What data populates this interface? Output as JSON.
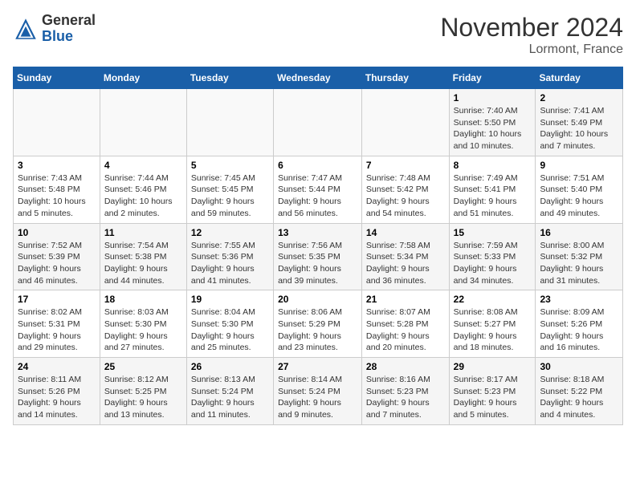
{
  "header": {
    "logo_general": "General",
    "logo_blue": "Blue",
    "month_year": "November 2024",
    "location": "Lormont, France"
  },
  "weekdays": [
    "Sunday",
    "Monday",
    "Tuesday",
    "Wednesday",
    "Thursday",
    "Friday",
    "Saturday"
  ],
  "weeks": [
    [
      {
        "day": "",
        "info": ""
      },
      {
        "day": "",
        "info": ""
      },
      {
        "day": "",
        "info": ""
      },
      {
        "day": "",
        "info": ""
      },
      {
        "day": "",
        "info": ""
      },
      {
        "day": "1",
        "info": "Sunrise: 7:40 AM\nSunset: 5:50 PM\nDaylight: 10 hours and 10 minutes."
      },
      {
        "day": "2",
        "info": "Sunrise: 7:41 AM\nSunset: 5:49 PM\nDaylight: 10 hours and 7 minutes."
      }
    ],
    [
      {
        "day": "3",
        "info": "Sunrise: 7:43 AM\nSunset: 5:48 PM\nDaylight: 10 hours and 5 minutes."
      },
      {
        "day": "4",
        "info": "Sunrise: 7:44 AM\nSunset: 5:46 PM\nDaylight: 10 hours and 2 minutes."
      },
      {
        "day": "5",
        "info": "Sunrise: 7:45 AM\nSunset: 5:45 PM\nDaylight: 9 hours and 59 minutes."
      },
      {
        "day": "6",
        "info": "Sunrise: 7:47 AM\nSunset: 5:44 PM\nDaylight: 9 hours and 56 minutes."
      },
      {
        "day": "7",
        "info": "Sunrise: 7:48 AM\nSunset: 5:42 PM\nDaylight: 9 hours and 54 minutes."
      },
      {
        "day": "8",
        "info": "Sunrise: 7:49 AM\nSunset: 5:41 PM\nDaylight: 9 hours and 51 minutes."
      },
      {
        "day": "9",
        "info": "Sunrise: 7:51 AM\nSunset: 5:40 PM\nDaylight: 9 hours and 49 minutes."
      }
    ],
    [
      {
        "day": "10",
        "info": "Sunrise: 7:52 AM\nSunset: 5:39 PM\nDaylight: 9 hours and 46 minutes."
      },
      {
        "day": "11",
        "info": "Sunrise: 7:54 AM\nSunset: 5:38 PM\nDaylight: 9 hours and 44 minutes."
      },
      {
        "day": "12",
        "info": "Sunrise: 7:55 AM\nSunset: 5:36 PM\nDaylight: 9 hours and 41 minutes."
      },
      {
        "day": "13",
        "info": "Sunrise: 7:56 AM\nSunset: 5:35 PM\nDaylight: 9 hours and 39 minutes."
      },
      {
        "day": "14",
        "info": "Sunrise: 7:58 AM\nSunset: 5:34 PM\nDaylight: 9 hours and 36 minutes."
      },
      {
        "day": "15",
        "info": "Sunrise: 7:59 AM\nSunset: 5:33 PM\nDaylight: 9 hours and 34 minutes."
      },
      {
        "day": "16",
        "info": "Sunrise: 8:00 AM\nSunset: 5:32 PM\nDaylight: 9 hours and 31 minutes."
      }
    ],
    [
      {
        "day": "17",
        "info": "Sunrise: 8:02 AM\nSunset: 5:31 PM\nDaylight: 9 hours and 29 minutes."
      },
      {
        "day": "18",
        "info": "Sunrise: 8:03 AM\nSunset: 5:30 PM\nDaylight: 9 hours and 27 minutes."
      },
      {
        "day": "19",
        "info": "Sunrise: 8:04 AM\nSunset: 5:30 PM\nDaylight: 9 hours and 25 minutes."
      },
      {
        "day": "20",
        "info": "Sunrise: 8:06 AM\nSunset: 5:29 PM\nDaylight: 9 hours and 23 minutes."
      },
      {
        "day": "21",
        "info": "Sunrise: 8:07 AM\nSunset: 5:28 PM\nDaylight: 9 hours and 20 minutes."
      },
      {
        "day": "22",
        "info": "Sunrise: 8:08 AM\nSunset: 5:27 PM\nDaylight: 9 hours and 18 minutes."
      },
      {
        "day": "23",
        "info": "Sunrise: 8:09 AM\nSunset: 5:26 PM\nDaylight: 9 hours and 16 minutes."
      }
    ],
    [
      {
        "day": "24",
        "info": "Sunrise: 8:11 AM\nSunset: 5:26 PM\nDaylight: 9 hours and 14 minutes."
      },
      {
        "day": "25",
        "info": "Sunrise: 8:12 AM\nSunset: 5:25 PM\nDaylight: 9 hours and 13 minutes."
      },
      {
        "day": "26",
        "info": "Sunrise: 8:13 AM\nSunset: 5:24 PM\nDaylight: 9 hours and 11 minutes."
      },
      {
        "day": "27",
        "info": "Sunrise: 8:14 AM\nSunset: 5:24 PM\nDaylight: 9 hours and 9 minutes."
      },
      {
        "day": "28",
        "info": "Sunrise: 8:16 AM\nSunset: 5:23 PM\nDaylight: 9 hours and 7 minutes."
      },
      {
        "day": "29",
        "info": "Sunrise: 8:17 AM\nSunset: 5:23 PM\nDaylight: 9 hours and 5 minutes."
      },
      {
        "day": "30",
        "info": "Sunrise: 8:18 AM\nSunset: 5:22 PM\nDaylight: 9 hours and 4 minutes."
      }
    ]
  ]
}
